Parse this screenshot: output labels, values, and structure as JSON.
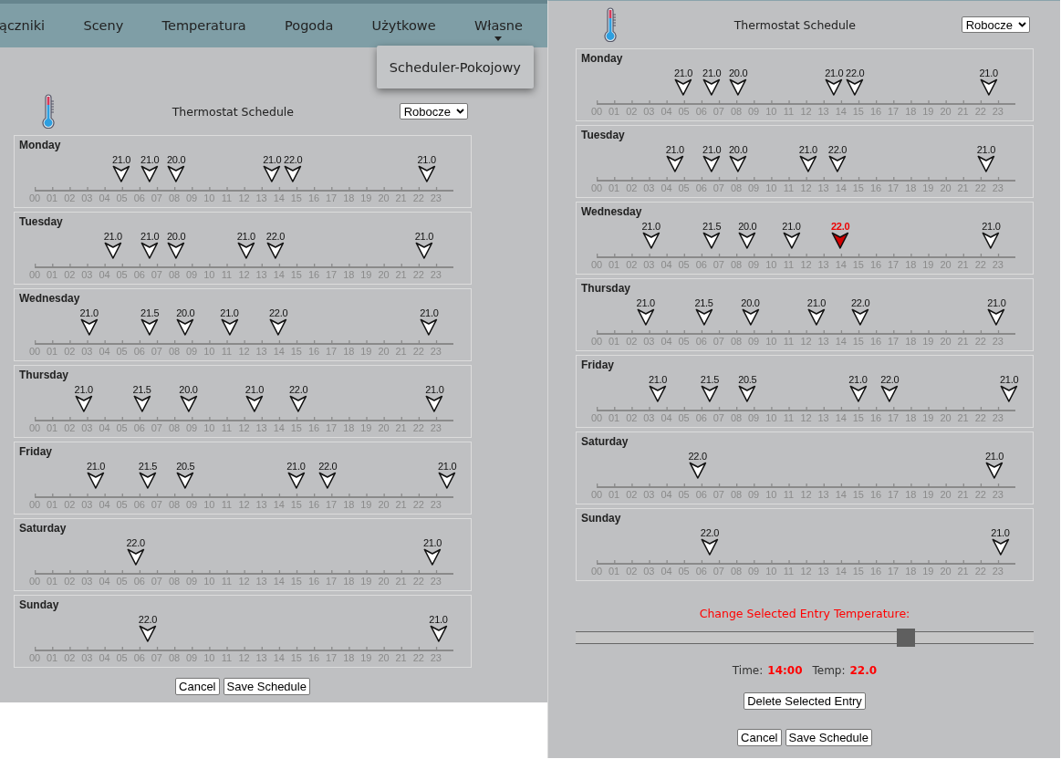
{
  "left_view": {
    "nav": {
      "items": [
        {
          "label": "ączniki",
          "expanded": false
        },
        {
          "label": "Sceny",
          "expanded": false
        },
        {
          "label": "Temperatura",
          "expanded": false
        },
        {
          "label": "Pogoda",
          "expanded": false
        },
        {
          "label": "Użytkowe",
          "expanded": false
        },
        {
          "label": "Własne",
          "expanded": true
        }
      ],
      "dropdown": [
        {
          "label": "Scheduler-Pokojowy"
        }
      ]
    },
    "scheduler": {
      "title": "Thermostat Schedule",
      "mode": "Robocze",
      "days": [
        {
          "name": "Monday",
          "entries": [
            {
              "temp": "21.0",
              "level": 0.207,
              "selected": false
            },
            {
              "temp": "21.0",
              "level": 0.275,
              "selected": false
            },
            {
              "temp": "20.0",
              "level": 0.338,
              "selected": false
            },
            {
              "temp": "21.0",
              "level": 0.567,
              "selected": false
            },
            {
              "temp": "22.0",
              "level": 0.617,
              "selected": false
            },
            {
              "temp": "21.0",
              "level": 0.936,
              "selected": false
            }
          ],
          "hours": [
            "00",
            "01",
            "02",
            "03",
            "04",
            "05",
            "06",
            "07",
            "08",
            "09",
            "10",
            "11",
            "12",
            "13",
            "14",
            "15",
            "16",
            "17",
            "18",
            "19",
            "20",
            "21",
            "22",
            "23"
          ]
        },
        {
          "name": "Tuesday",
          "entries": [
            {
              "temp": "21.0",
              "level": 0.187,
              "selected": false
            },
            {
              "temp": "21.0",
              "level": 0.275,
              "selected": false
            },
            {
              "temp": "20.0",
              "level": 0.338,
              "selected": false
            },
            {
              "temp": "21.0",
              "level": 0.505,
              "selected": false
            },
            {
              "temp": "22.0",
              "level": 0.575,
              "selected": false
            },
            {
              "temp": "21.0",
              "level": 0.93,
              "selected": false
            }
          ],
          "hours": [
            "00",
            "01",
            "02",
            "03",
            "04",
            "05",
            "06",
            "07",
            "08",
            "09",
            "10",
            "11",
            "12",
            "13",
            "14",
            "15",
            "16",
            "17",
            "18",
            "19",
            "20",
            "21",
            "22",
            "23"
          ]
        },
        {
          "name": "Wednesday",
          "entries": [
            {
              "temp": "21.0",
              "level": 0.13,
              "selected": false
            },
            {
              "temp": "21.5",
              "level": 0.275,
              "selected": false
            },
            {
              "temp": "20.0",
              "level": 0.36,
              "selected": false
            },
            {
              "temp": "21.0",
              "level": 0.465,
              "selected": false
            },
            {
              "temp": "22.0",
              "level": 0.582,
              "selected": false
            },
            {
              "temp": "21.0",
              "level": 0.942,
              "selected": false
            }
          ],
          "hours": [
            "00",
            "01",
            "02",
            "03",
            "04",
            "05",
            "06",
            "07",
            "08",
            "09",
            "10",
            "11",
            "12",
            "13",
            "14",
            "15",
            "16",
            "17",
            "18",
            "19",
            "20",
            "21",
            "22",
            "23"
          ]
        },
        {
          "name": "Thursday",
          "entries": [
            {
              "temp": "21.0",
              "level": 0.117,
              "selected": false
            },
            {
              "temp": "21.5",
              "level": 0.256,
              "selected": false
            },
            {
              "temp": "20.0",
              "level": 0.367,
              "selected": false
            },
            {
              "temp": "21.0",
              "level": 0.525,
              "selected": false
            },
            {
              "temp": "22.0",
              "level": 0.63,
              "selected": false
            },
            {
              "temp": "21.0",
              "level": 0.955,
              "selected": false
            }
          ],
          "hours": [
            "00",
            "01",
            "02",
            "03",
            "04",
            "05",
            "06",
            "07",
            "08",
            "09",
            "10",
            "11",
            "12",
            "13",
            "14",
            "15",
            "16",
            "17",
            "18",
            "19",
            "20",
            "21",
            "22",
            "23"
          ]
        },
        {
          "name": "Friday",
          "entries": [
            {
              "temp": "21.0",
              "level": 0.146,
              "selected": false
            },
            {
              "temp": "21.5",
              "level": 0.27,
              "selected": false
            },
            {
              "temp": "20.5",
              "level": 0.36,
              "selected": false
            },
            {
              "temp": "21.0",
              "level": 0.624,
              "selected": false
            },
            {
              "temp": "22.0",
              "level": 0.7,
              "selected": false
            },
            {
              "temp": "21.0",
              "level": 0.985,
              "selected": false
            }
          ],
          "hours": [
            "00",
            "01",
            "02",
            "03",
            "04",
            "05",
            "06",
            "07",
            "08",
            "09",
            "10",
            "11",
            "12",
            "13",
            "14",
            "15",
            "16",
            "17",
            "18",
            "19",
            "20",
            "21",
            "22",
            "23"
          ]
        },
        {
          "name": "Saturday",
          "entries": [
            {
              "temp": "22.0",
              "level": 0.241,
              "selected": false
            },
            {
              "temp": "21.0",
              "level": 0.95,
              "selected": false
            }
          ],
          "hours": [
            "00",
            "01",
            "02",
            "03",
            "04",
            "05",
            "06",
            "07",
            "08",
            "09",
            "10",
            "11",
            "12",
            "13",
            "14",
            "15",
            "16",
            "17",
            "18",
            "19",
            "20",
            "21",
            "22",
            "23"
          ]
        },
        {
          "name": "Sunday",
          "entries": [
            {
              "temp": "22.0",
              "level": 0.27,
              "selected": false
            },
            {
              "temp": "21.0",
              "level": 0.964,
              "selected": false
            }
          ],
          "hours": [
            "00",
            "01",
            "02",
            "03",
            "04",
            "05",
            "06",
            "07",
            "08",
            "09",
            "10",
            "11",
            "12",
            "13",
            "14",
            "15",
            "16",
            "17",
            "18",
            "19",
            "20",
            "21",
            "22",
            "23"
          ]
        }
      ],
      "buttons": [
        {
          "label": "Cancel"
        },
        {
          "label": "Save Schedule"
        }
      ]
    }
  },
  "right_view": {
    "scheduler": {
      "title": "Thermostat Schedule",
      "mode": "Robocze",
      "days": [
        {
          "name": "Monday",
          "entries": [
            {
              "temp": "21.0",
              "level": 0.207,
              "selected": false
            },
            {
              "temp": "21.0",
              "level": 0.275,
              "selected": false
            },
            {
              "temp": "20.0",
              "level": 0.338,
              "selected": false
            },
            {
              "temp": "21.0",
              "level": 0.567,
              "selected": false
            },
            {
              "temp": "22.0",
              "level": 0.617,
              "selected": false
            },
            {
              "temp": "21.0",
              "level": 0.936,
              "selected": false
            }
          ],
          "hours": [
            "00",
            "01",
            "02",
            "03",
            "04",
            "05",
            "06",
            "07",
            "08",
            "09",
            "10",
            "11",
            "12",
            "13",
            "14",
            "15",
            "16",
            "17",
            "18",
            "19",
            "20",
            "21",
            "22",
            "23"
          ]
        },
        {
          "name": "Tuesday",
          "entries": [
            {
              "temp": "21.0",
              "level": 0.187,
              "selected": false
            },
            {
              "temp": "21.0",
              "level": 0.275,
              "selected": false
            },
            {
              "temp": "20.0",
              "level": 0.338,
              "selected": false
            },
            {
              "temp": "21.0",
              "level": 0.505,
              "selected": false
            },
            {
              "temp": "22.0",
              "level": 0.575,
              "selected": false
            },
            {
              "temp": "21.0",
              "level": 0.93,
              "selected": false
            }
          ],
          "hours": [
            "00",
            "01",
            "02",
            "03",
            "04",
            "05",
            "06",
            "07",
            "08",
            "09",
            "10",
            "11",
            "12",
            "13",
            "14",
            "15",
            "16",
            "17",
            "18",
            "19",
            "20",
            "21",
            "22",
            "23"
          ]
        },
        {
          "name": "Wednesday",
          "entries": [
            {
              "temp": "21.0",
              "level": 0.13,
              "selected": false
            },
            {
              "temp": "21.5",
              "level": 0.275,
              "selected": false
            },
            {
              "temp": "20.0",
              "level": 0.36,
              "selected": false
            },
            {
              "temp": "21.0",
              "level": 0.465,
              "selected": false
            },
            {
              "temp": "22.0",
              "level": 0.582,
              "selected": true
            },
            {
              "temp": "21.0",
              "level": 0.942,
              "selected": false
            }
          ],
          "hours": [
            "00",
            "01",
            "02",
            "03",
            "04",
            "05",
            "06",
            "07",
            "08",
            "09",
            "10",
            "11",
            "12",
            "13",
            "14",
            "15",
            "16",
            "17",
            "18",
            "19",
            "20",
            "21",
            "22",
            "23"
          ]
        },
        {
          "name": "Thursday",
          "entries": [
            {
              "temp": "21.0",
              "level": 0.117,
              "selected": false
            },
            {
              "temp": "21.5",
              "level": 0.256,
              "selected": false
            },
            {
              "temp": "20.0",
              "level": 0.367,
              "selected": false
            },
            {
              "temp": "21.0",
              "level": 0.525,
              "selected": false
            },
            {
              "temp": "22.0",
              "level": 0.63,
              "selected": false
            },
            {
              "temp": "21.0",
              "level": 0.955,
              "selected": false
            }
          ],
          "hours": [
            "00",
            "01",
            "02",
            "03",
            "04",
            "05",
            "06",
            "07",
            "08",
            "09",
            "10",
            "11",
            "12",
            "13",
            "14",
            "15",
            "16",
            "17",
            "18",
            "19",
            "20",
            "21",
            "22",
            "23"
          ]
        },
        {
          "name": "Friday",
          "entries": [
            {
              "temp": "21.0",
              "level": 0.146,
              "selected": false
            },
            {
              "temp": "21.5",
              "level": 0.27,
              "selected": false
            },
            {
              "temp": "20.5",
              "level": 0.36,
              "selected": false
            },
            {
              "temp": "21.0",
              "level": 0.624,
              "selected": false
            },
            {
              "temp": "22.0",
              "level": 0.7,
              "selected": false
            },
            {
              "temp": "21.0",
              "level": 0.985,
              "selected": false
            }
          ],
          "hours": [
            "00",
            "01",
            "02",
            "03",
            "04",
            "05",
            "06",
            "07",
            "08",
            "09",
            "10",
            "11",
            "12",
            "13",
            "14",
            "15",
            "16",
            "17",
            "18",
            "19",
            "20",
            "21",
            "22",
            "23"
          ]
        },
        {
          "name": "Saturday",
          "entries": [
            {
              "temp": "22.0",
              "level": 0.241,
              "selected": false
            },
            {
              "temp": "21.0",
              "level": 0.95,
              "selected": false
            }
          ],
          "hours": [
            "00",
            "01",
            "02",
            "03",
            "04",
            "05",
            "06",
            "07",
            "08",
            "09",
            "10",
            "11",
            "12",
            "13",
            "14",
            "15",
            "16",
            "17",
            "18",
            "19",
            "20",
            "21",
            "22",
            "23"
          ]
        },
        {
          "name": "Sunday",
          "entries": [
            {
              "temp": "22.0",
              "level": 0.27,
              "selected": false
            },
            {
              "temp": "21.0",
              "level": 0.964,
              "selected": false
            }
          ],
          "hours": [
            "00",
            "01",
            "02",
            "03",
            "04",
            "05",
            "06",
            "07",
            "08",
            "09",
            "10",
            "11",
            "12",
            "13",
            "14",
            "15",
            "16",
            "17",
            "18",
            "19",
            "20",
            "21",
            "22",
            "23"
          ]
        }
      ],
      "editor": {
        "prompt": "Change Selected Entry Temperature:",
        "slider": {
          "level": 0.73
        },
        "time_label": "Time:",
        "time": "14:00",
        "temp_label": "Temp:",
        "temp": "22.0",
        "delete_button": "Delete Selected Entry"
      },
      "buttons": [
        {
          "label": "Cancel"
        },
        {
          "label": "Save Schedule"
        }
      ]
    }
  }
}
